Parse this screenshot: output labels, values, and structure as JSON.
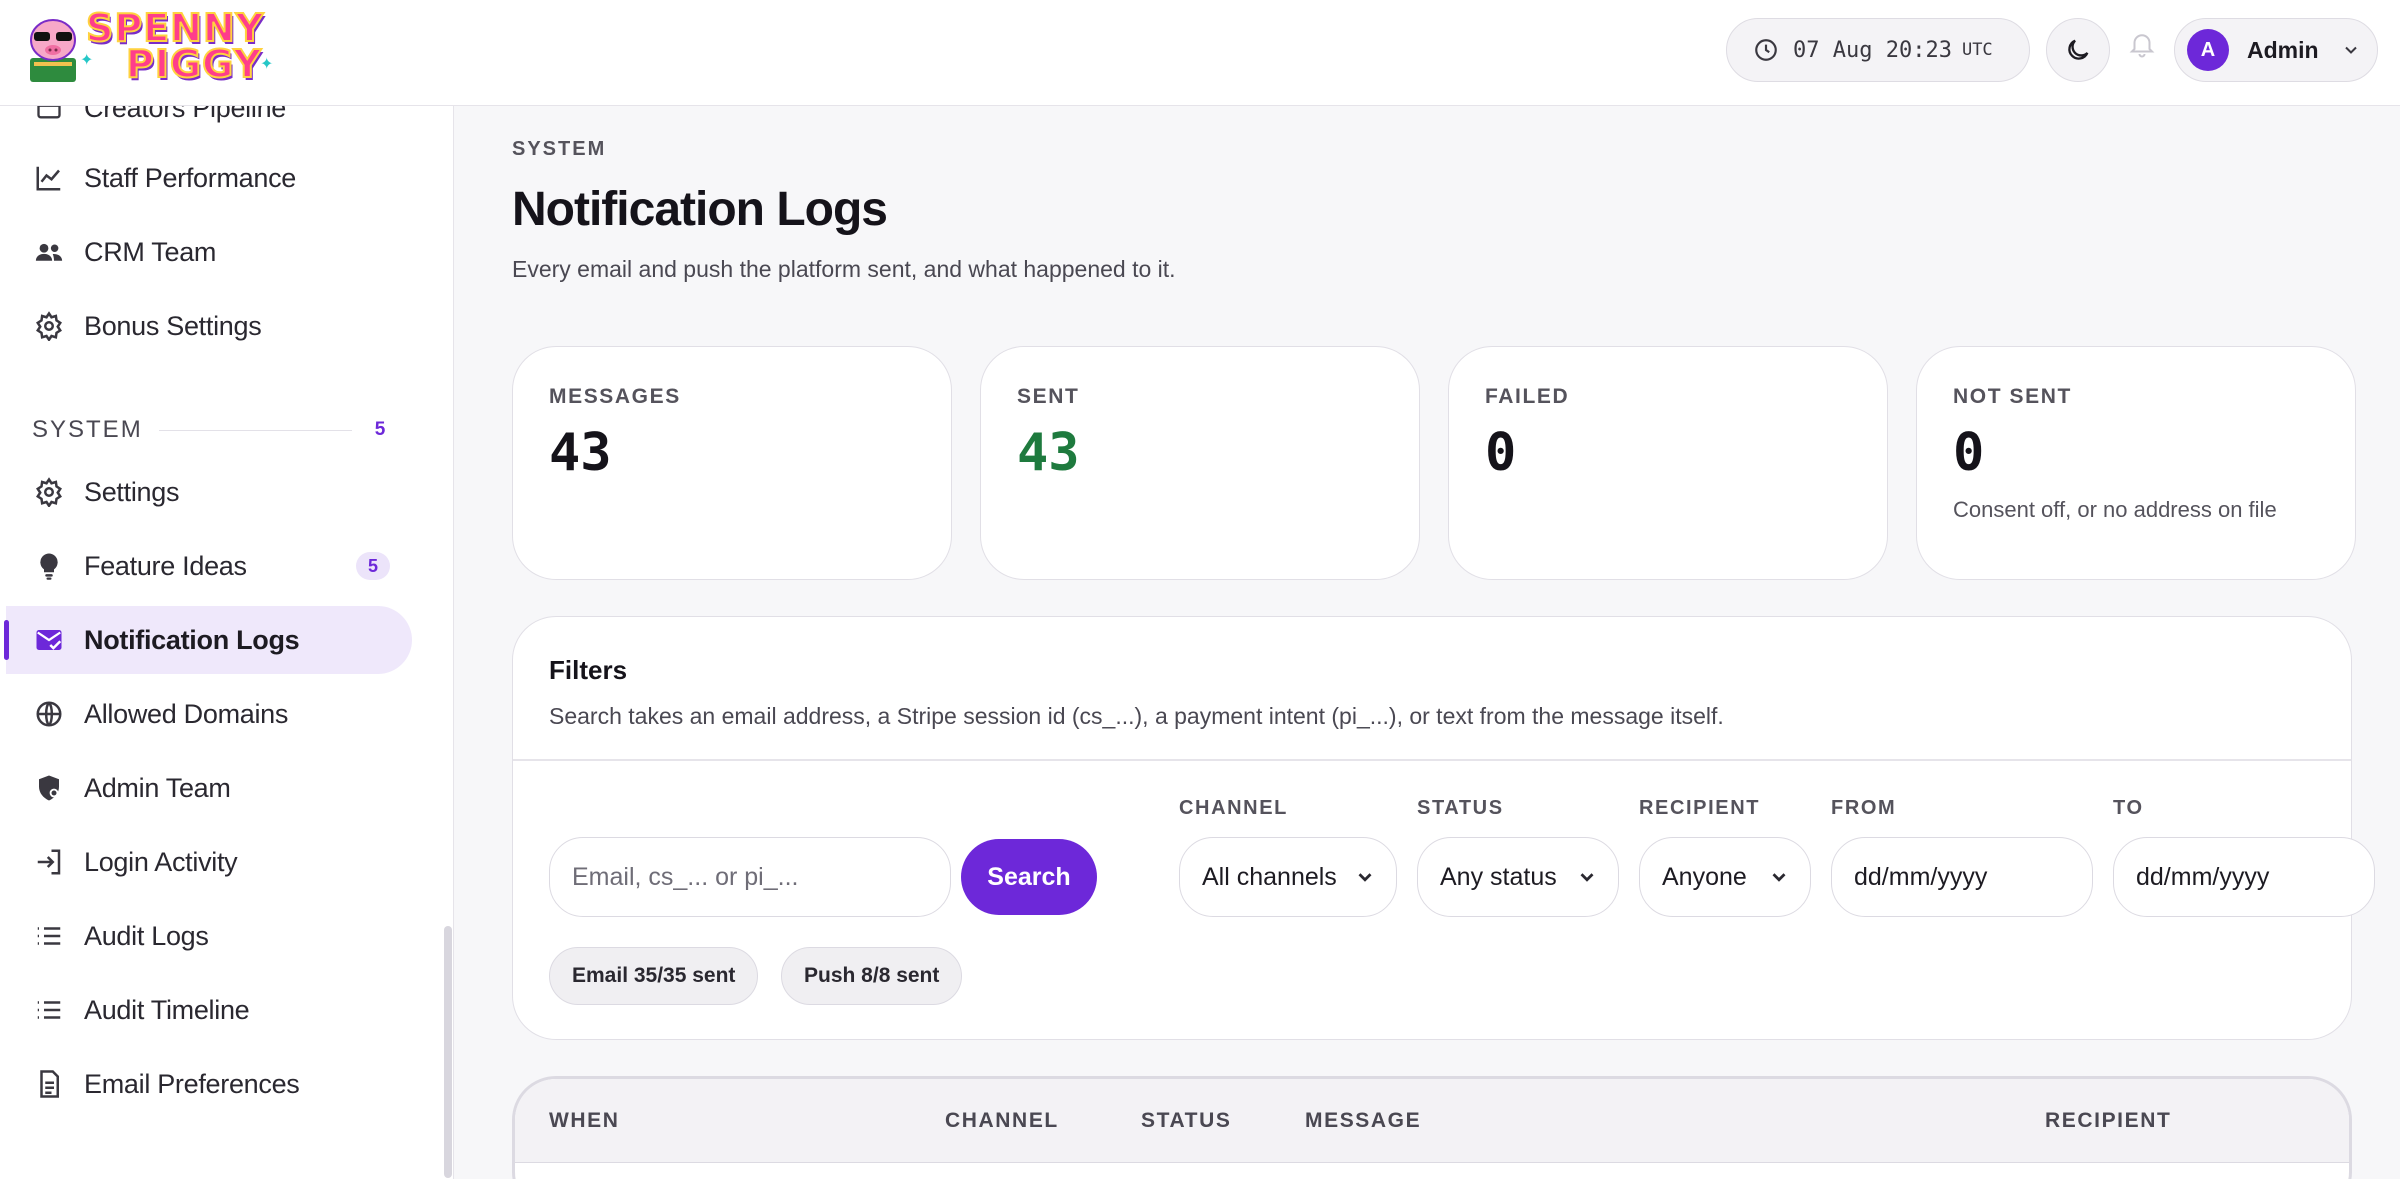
{
  "brand": {
    "line1": "SPENNY",
    "line2": "PIGGY"
  },
  "header": {
    "clock_time": "07 Aug 20:23",
    "clock_tz": "UTC",
    "user_initial": "A",
    "user_name": "Admin"
  },
  "sidebar": {
    "items_top": [
      {
        "label": "Creators Pipeline",
        "icon": "pipeline-icon"
      },
      {
        "label": "Staff Performance",
        "icon": "chart-line-icon"
      },
      {
        "label": "CRM Team",
        "icon": "users-icon"
      },
      {
        "label": "Bonus Settings",
        "icon": "gear-icon"
      }
    ],
    "section": {
      "title": "SYSTEM",
      "count": "5"
    },
    "items_system": [
      {
        "label": "Settings",
        "icon": "gear-icon"
      },
      {
        "label": "Feature Ideas",
        "icon": "lightbulb-icon",
        "badge": "5"
      },
      {
        "label": "Notification Logs",
        "icon": "mail-check-icon",
        "active": true
      },
      {
        "label": "Allowed Domains",
        "icon": "globe-icon"
      },
      {
        "label": "Admin Team",
        "icon": "shield-user-icon"
      },
      {
        "label": "Login Activity",
        "icon": "login-icon"
      },
      {
        "label": "Audit Logs",
        "icon": "list-icon"
      },
      {
        "label": "Audit Timeline",
        "icon": "list-icon"
      },
      {
        "label": "Email Preferences",
        "icon": "document-icon"
      }
    ]
  },
  "page": {
    "eyebrow": "SYSTEM",
    "title": "Notification Logs",
    "subtitle": "Every email and push the platform sent, and what happened to it."
  },
  "stats": [
    {
      "label": "MESSAGES",
      "value": "43",
      "note": ""
    },
    {
      "label": "SENT",
      "value": "43",
      "note": ""
    },
    {
      "label": "FAILED",
      "value": "0",
      "note": ""
    },
    {
      "label": "NOT SENT",
      "value": "0",
      "note": "Consent off, or no address on file"
    }
  ],
  "filters": {
    "title": "Filters",
    "description": "Search takes an email address, a Stripe session id (cs_...), a payment intent (pi_...), or text from the message itself.",
    "search_placeholder": "Email, cs_... or pi_...",
    "search_button": "Search",
    "channel": {
      "label": "CHANNEL",
      "value": "All channels"
    },
    "status": {
      "label": "STATUS",
      "value": "Any status"
    },
    "recipient": {
      "label": "RECIPIENT",
      "value": "Anyone"
    },
    "from": {
      "label": "FROM",
      "value": "dd/mm/yyyy"
    },
    "to": {
      "label": "TO",
      "value": "dd/mm/yyyy"
    },
    "chips": [
      "Email 35/35 sent",
      "Push 8/8 sent"
    ]
  },
  "table": {
    "columns": [
      "WHEN",
      "CHANNEL",
      "STATUS",
      "MESSAGE",
      "RECIPIENT"
    ]
  },
  "colors": {
    "accent": "#6d28d9",
    "success": "#1e7a3e",
    "brand_pink": "#ff3d8b"
  }
}
